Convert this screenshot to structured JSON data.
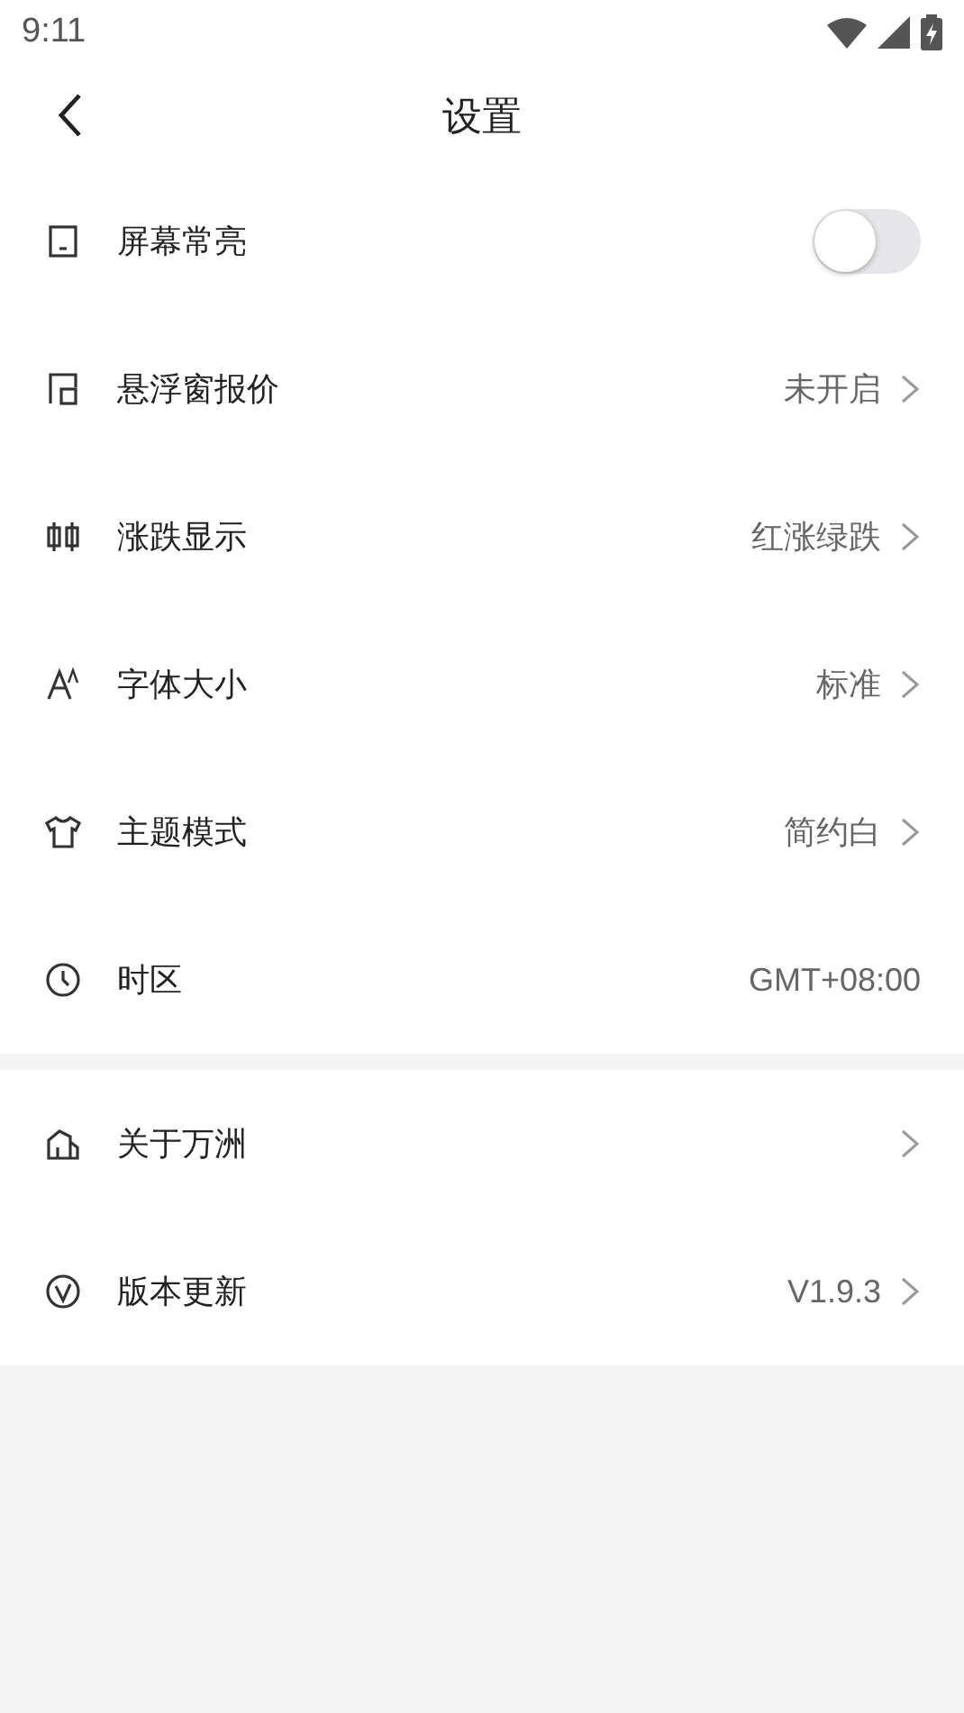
{
  "status_bar": {
    "time": "9:11"
  },
  "header": {
    "title": "设置"
  },
  "sections": [
    {
      "items": [
        {
          "kind": "toggle",
          "label": "屏幕常亮",
          "on": false
        },
        {
          "kind": "link",
          "label": "悬浮窗报价",
          "value": "未开启"
        },
        {
          "kind": "link",
          "label": "涨跌显示",
          "value": "红涨绿跌"
        },
        {
          "kind": "link",
          "label": "字体大小",
          "value": "标准"
        },
        {
          "kind": "link",
          "label": "主题模式",
          "value": "简约白"
        },
        {
          "kind": "text",
          "label": "时区",
          "value": "GMT+08:00"
        }
      ]
    },
    {
      "items": [
        {
          "kind": "link",
          "label": "关于万洲"
        },
        {
          "kind": "link",
          "label": "版本更新",
          "value": "V1.9.3"
        }
      ]
    }
  ]
}
